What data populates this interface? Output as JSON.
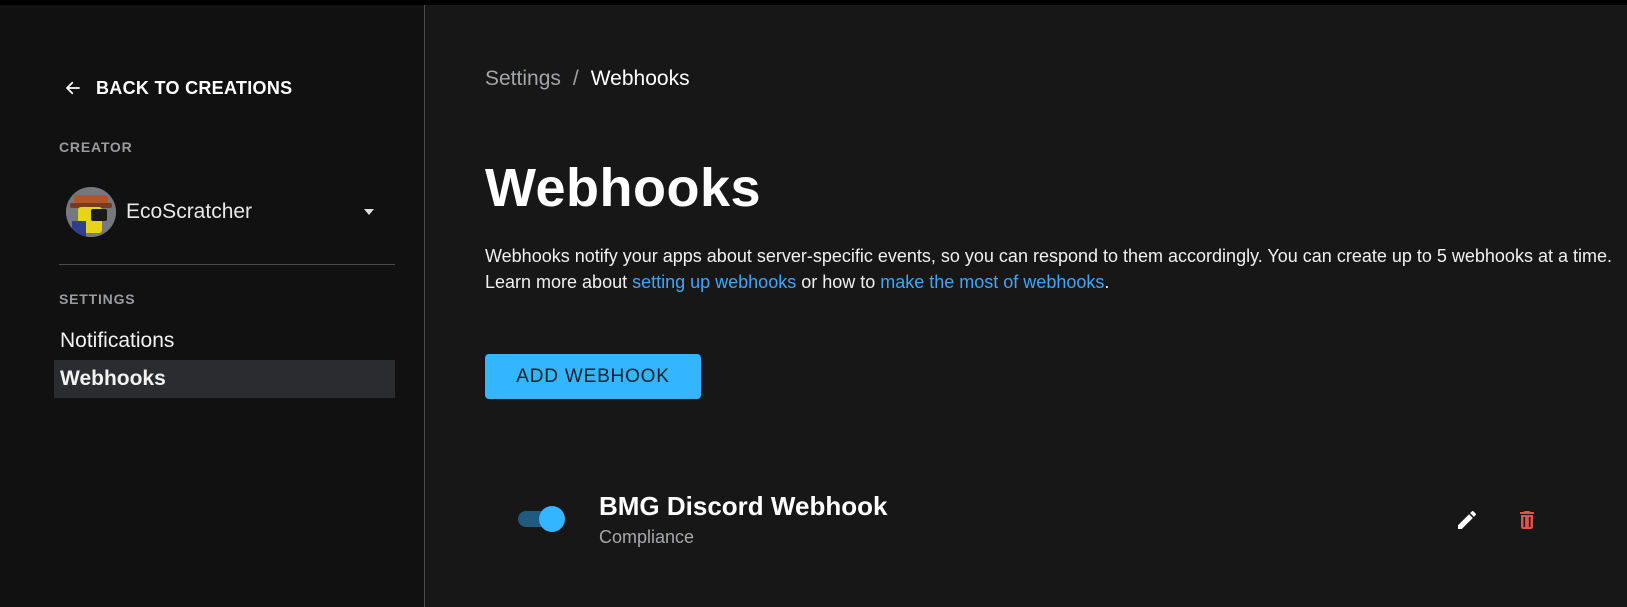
{
  "sidebar": {
    "back_label": "BACK TO CREATIONS",
    "creator_section": "CREATOR",
    "creator_name": "EcoScratcher",
    "settings_section": "SETTINGS",
    "items": [
      {
        "label": "Notifications",
        "active": false
      },
      {
        "label": "Webhooks",
        "active": true
      }
    ]
  },
  "breadcrumb": {
    "parent": "Settings",
    "separator": "/",
    "current": "Webhooks"
  },
  "page": {
    "title": "Webhooks",
    "desc_text_1": "Webhooks notify your apps about server-specific events, so you can respond to them accordingly. You can create up to 5 webhooks at a time. Learn more about ",
    "desc_link_1": "setting up webhooks",
    "desc_text_2": " or how to ",
    "desc_link_2": "make the most of webhooks",
    "desc_text_3": ".",
    "add_button": "ADD WEBHOOK"
  },
  "webhooks": [
    {
      "name": "BMG Discord Webhook",
      "type": "Compliance",
      "enabled": true
    }
  ],
  "icons": {
    "back": "arrow-left-icon",
    "dropdown": "chevron-down-icon",
    "edit": "pencil-icon",
    "delete": "trash-icon"
  },
  "colors": {
    "accent": "#33b5ff",
    "link": "#3ea6ff",
    "delete": "#e0524b",
    "background": "#171718",
    "sidebar_bg": "#111112"
  }
}
